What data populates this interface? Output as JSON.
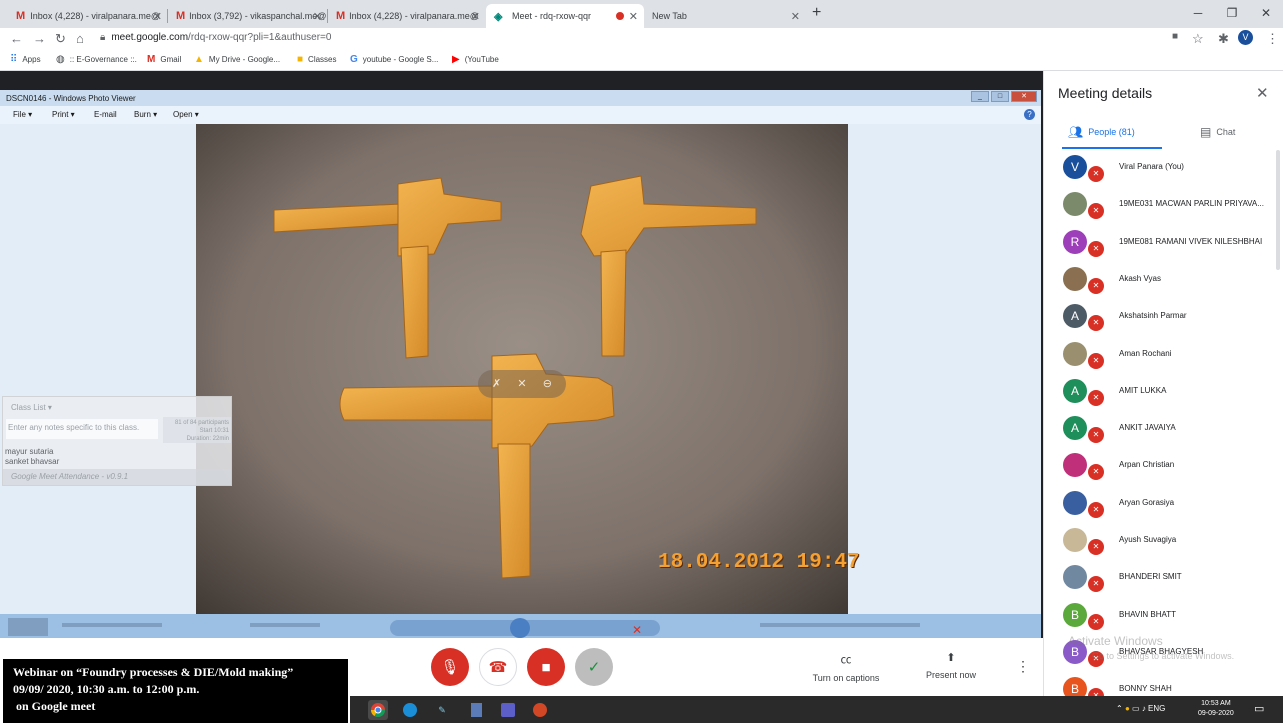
{
  "browser": {
    "tabs": [
      {
        "label": "Inbox (4,228) - viralpanara.me@",
        "icon": "gmail-icon"
      },
      {
        "label": "Inbox (3,792) - vikaspanchal.me@",
        "icon": "gmail-icon"
      },
      {
        "label": "Inbox (4,228) - viralpanara.me@",
        "icon": "gmail-icon"
      },
      {
        "label": "Meet - rdq-rxow-qqr",
        "icon": "meet-icon"
      },
      {
        "label": "New Tab",
        "icon": ""
      }
    ],
    "url_host": "meet.google.com",
    "url_path": "/rdq-rxow-qqr?pli=1&authuser=0",
    "profile_initial": "V",
    "bookmarks": [
      "Apps",
      ":: E-Governance ::.",
      "Gmail",
      "My Drive - Google...",
      "Classes",
      "youtube - Google S...",
      "(YouTube"
    ]
  },
  "photo_viewer": {
    "title": "DSCN0146 - Windows Photo Viewer",
    "menu": [
      "File",
      "Print",
      "E-mail",
      "Burn",
      "Open"
    ],
    "date_stamp": "18.04.2012  19:47"
  },
  "class_list": {
    "header": "Class List",
    "placeholder": "Enter any notes specific to this class.",
    "stats": "81 of 84 participants",
    "stat2": "Start 10:31",
    "stat3": "Duration: 22min",
    "students": [
      "mayur sutaria",
      "sanket bhavsar"
    ],
    "footer": "Google Meet Attendance - v0.9.1"
  },
  "controls": {
    "captions_label": "Turn on captions",
    "present_label": "Present now"
  },
  "webinar": {
    "line1": "Webinar on “Foundry processes & DIE/Mold making”",
    "line2": "09/09/ 2020, 10:30 a.m. to 12:00 p.m.",
    "line3": " on Google meet"
  },
  "panel": {
    "title": "Meeting details",
    "people_tab": "People (81)",
    "chat_tab": "Chat",
    "watermark1": "Activate Windows",
    "watermark2": "Go to Settings to activate Windows.",
    "participants": [
      {
        "name": "Viral Panara (You)",
        "initial": "V",
        "color": "#1a4f9c"
      },
      {
        "name": "19ME031 MACWAN PARLIN PRIYAVA...",
        "initial": "",
        "color": "#7a8a6a"
      },
      {
        "name": "19ME081 RAMANI VIVEK NILESHBHAI",
        "initial": "R",
        "color": "#9c3fb8"
      },
      {
        "name": "Akash Vyas",
        "initial": "",
        "color": "#8a7050"
      },
      {
        "name": "Akshatsinh Parmar",
        "initial": "A",
        "color": "#4d5b66"
      },
      {
        "name": "Aman Rochani",
        "initial": "",
        "color": "#9a9070"
      },
      {
        "name": "AMIT LUKKA",
        "initial": "A",
        "color": "#1e8e5a"
      },
      {
        "name": "ANKIT JAVAIYA",
        "initial": "A",
        "color": "#1e8e5a"
      },
      {
        "name": "Arpan Christian",
        "initial": "",
        "color": "#c0307a"
      },
      {
        "name": "Aryan Gorasiya",
        "initial": "",
        "color": "#3a5fa0"
      },
      {
        "name": "Ayush Suvagiya",
        "initial": "",
        "color": "#c8b898"
      },
      {
        "name": "BHANDERI SMIT",
        "initial": "",
        "color": "#7088a0"
      },
      {
        "name": "BHAVIN BHATT",
        "initial": "B",
        "color": "#5ba83c"
      },
      {
        "name": "BHAVSAR BHAGYESH",
        "initial": "B",
        "color": "#8a5ac8"
      },
      {
        "name": "BONNY SHAH",
        "initial": "B",
        "color": "#e8541e"
      }
    ]
  },
  "taskbar": {
    "time": "10:53 AM",
    "date": "09-09-2020",
    "lang": "ENG"
  }
}
